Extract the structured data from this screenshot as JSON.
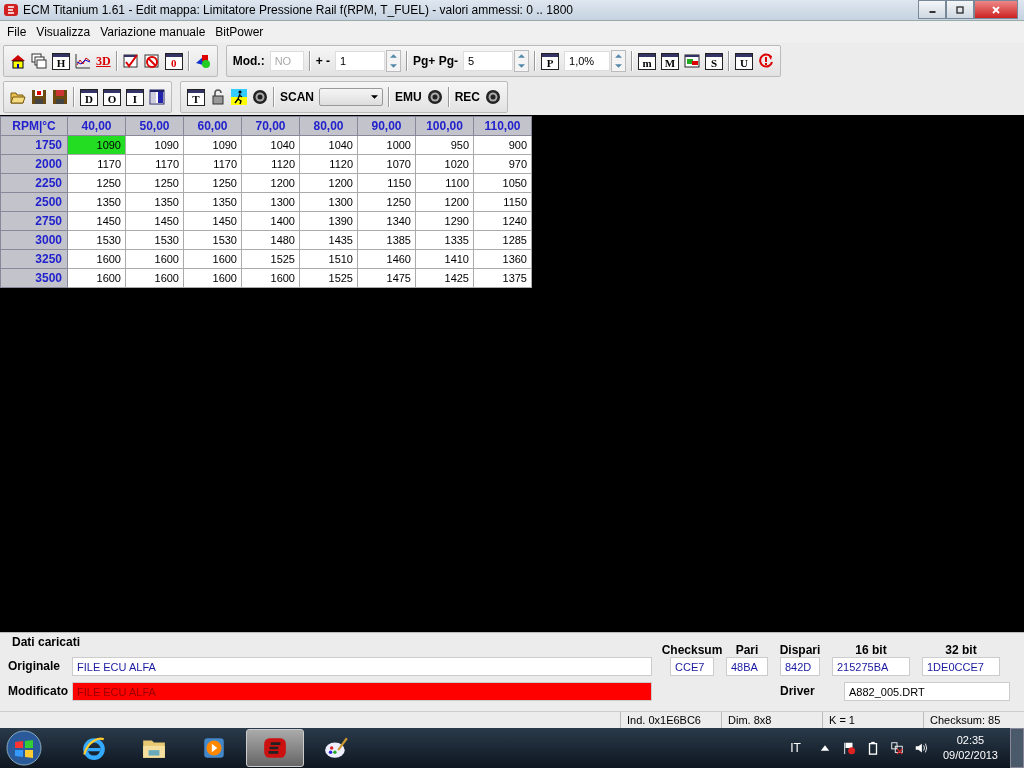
{
  "window": {
    "title": "ECM Titanium 1.61 - Edit mappa: Limitatore Pressione Rail f(RPM, T_FUEL) - valori ammessi: 0 .. 1800"
  },
  "menu": [
    "File",
    "Visualizza",
    "Variazione manuale",
    "BitPower"
  ],
  "toolbar_main": {
    "letter_icons": [
      "H",
      "3D",
      "0"
    ],
    "mod_label": "Mod.:",
    "mod_value": "NO",
    "step_label": "+ -",
    "step_value": "1",
    "page_label": "Pg+ Pg-",
    "page_value": "5",
    "percent_icon": "P",
    "percent_value": "1,0%",
    "right_letter_icons": [
      "m",
      "M",
      "S",
      "U"
    ]
  },
  "toolbar_file": {
    "letter_icons": [
      "D",
      "O",
      "I"
    ]
  },
  "toolbar_ecu": {
    "letter_icon": "T",
    "scan_label": "SCAN",
    "emu_label": "EMU",
    "rec_label": "REC"
  },
  "table": {
    "corner": "RPM|°C",
    "columns": [
      "40,00",
      "50,00",
      "60,00",
      "70,00",
      "80,00",
      "90,00",
      "100,00",
      "110,00"
    ],
    "rows": [
      {
        "rpm": "1750",
        "cells": [
          {
            "value": "1090",
            "selected": true
          },
          {
            "value": "1090",
            "selected": false
          },
          {
            "value": "1090",
            "selected": false
          },
          {
            "value": "1040",
            "selected": false
          },
          {
            "value": "1040",
            "selected": false
          },
          {
            "value": "1000",
            "selected": false
          },
          {
            "value": "950",
            "selected": false
          },
          {
            "value": "900",
            "selected": false
          }
        ]
      },
      {
        "rpm": "2000",
        "cells": [
          {
            "value": "1170",
            "selected": false
          },
          {
            "value": "1170",
            "selected": false
          },
          {
            "value": "1170",
            "selected": false
          },
          {
            "value": "1120",
            "selected": false
          },
          {
            "value": "1120",
            "selected": false
          },
          {
            "value": "1070",
            "selected": false
          },
          {
            "value": "1020",
            "selected": false
          },
          {
            "value": "970",
            "selected": false
          }
        ]
      },
      {
        "rpm": "2250",
        "cells": [
          {
            "value": "1250",
            "selected": false
          },
          {
            "value": "1250",
            "selected": false
          },
          {
            "value": "1250",
            "selected": false
          },
          {
            "value": "1200",
            "selected": false
          },
          {
            "value": "1200",
            "selected": false
          },
          {
            "value": "1150",
            "selected": false
          },
          {
            "value": "1100",
            "selected": false
          },
          {
            "value": "1050",
            "selected": false
          }
        ]
      },
      {
        "rpm": "2500",
        "cells": [
          {
            "value": "1350",
            "selected": false
          },
          {
            "value": "1350",
            "selected": false
          },
          {
            "value": "1350",
            "selected": false
          },
          {
            "value": "1300",
            "selected": false
          },
          {
            "value": "1300",
            "selected": false
          },
          {
            "value": "1250",
            "selected": false
          },
          {
            "value": "1200",
            "selected": false
          },
          {
            "value": "1150",
            "selected": false
          }
        ]
      },
      {
        "rpm": "2750",
        "cells": [
          {
            "value": "1450",
            "selected": false
          },
          {
            "value": "1450",
            "selected": false
          },
          {
            "value": "1450",
            "selected": false
          },
          {
            "value": "1400",
            "selected": false
          },
          {
            "value": "1390",
            "selected": false
          },
          {
            "value": "1340",
            "selected": false
          },
          {
            "value": "1290",
            "selected": false
          },
          {
            "value": "1240",
            "selected": false
          }
        ]
      },
      {
        "rpm": "3000",
        "cells": [
          {
            "value": "1530",
            "selected": false
          },
          {
            "value": "1530",
            "selected": false
          },
          {
            "value": "1530",
            "selected": false
          },
          {
            "value": "1480",
            "selected": false
          },
          {
            "value": "1435",
            "selected": false
          },
          {
            "value": "1385",
            "selected": false
          },
          {
            "value": "1335",
            "selected": false
          },
          {
            "value": "1285",
            "selected": false
          }
        ]
      },
      {
        "rpm": "3250",
        "cells": [
          {
            "value": "1600",
            "selected": false
          },
          {
            "value": "1600",
            "selected": false
          },
          {
            "value": "1600",
            "selected": false
          },
          {
            "value": "1525",
            "selected": false
          },
          {
            "value": "1510",
            "selected": false
          },
          {
            "value": "1460",
            "selected": false
          },
          {
            "value": "1410",
            "selected": false
          },
          {
            "value": "1360",
            "selected": false
          }
        ]
      },
      {
        "rpm": "3500",
        "cells": [
          {
            "value": "1600",
            "selected": false
          },
          {
            "value": "1600",
            "selected": false
          },
          {
            "value": "1600",
            "selected": false
          },
          {
            "value": "1600",
            "selected": false
          },
          {
            "value": "1525",
            "selected": false
          },
          {
            "value": "1475",
            "selected": false
          },
          {
            "value": "1425",
            "selected": false
          },
          {
            "value": "1375",
            "selected": false
          }
        ]
      }
    ]
  },
  "panel": {
    "title": "Dati caricati",
    "original_label": "Originale",
    "original_value": "FILE ECU ALFA",
    "modified_label": "Modificato",
    "modified_value": "FILE ECU ALFA",
    "modified": true,
    "checksums": [
      {
        "label": "Checksum",
        "value": "CCE7"
      },
      {
        "label": "Pari",
        "value": "48BA"
      },
      {
        "label": "Dispari",
        "value": "842D"
      },
      {
        "label": "16 bit",
        "value": "215275BA"
      },
      {
        "label": "32 bit",
        "value": "1DE0CCE7"
      }
    ],
    "driver_label": "Driver",
    "driver_value": "A882_005.DRT"
  },
  "status_bar": [
    "Ind. 0x1E6BC6",
    "Dim. 8x8",
    "K = 1",
    "Checksum: 85"
  ],
  "taskbar": {
    "apps": [
      {
        "selected": false
      },
      {
        "selected": false
      },
      {
        "selected": false
      },
      {
        "selected": true
      },
      {
        "selected": false
      }
    ],
    "language": "IT",
    "time": "02:35",
    "date": "09/02/2013"
  }
}
